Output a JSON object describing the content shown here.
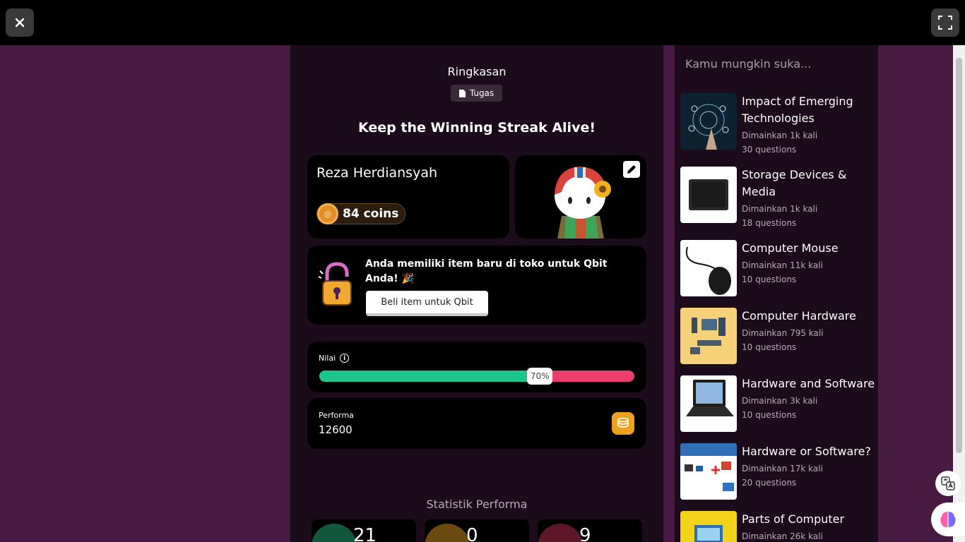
{
  "header": {
    "close_icon": "close-icon",
    "fullscreen_icon": "fullscreen-icon"
  },
  "summary": {
    "title": "Ringkasan",
    "tag_label": "Tugas"
  },
  "streak_title": "Keep the Winning Streak Alive!",
  "user": {
    "name": "Reza Herdiansyah",
    "coins": "84 coins"
  },
  "promo": {
    "text": "Anda memiliki item baru di toko untuk Qbit Anda! 🎉",
    "button_label": "Beli item untuk Qbit"
  },
  "score": {
    "label": "Nilai",
    "percent_label": "70%",
    "fraction": 0.7
  },
  "performance": {
    "label": "Performa",
    "value": "12600"
  },
  "stats": {
    "title": "Statistik Performa",
    "items": [
      {
        "value": "21",
        "color": "#10573c"
      },
      {
        "value": "0",
        "color": "#6b4a10"
      },
      {
        "value": "9",
        "color": "#5c1627"
      }
    ]
  },
  "sidebar": {
    "heading": "Kamu mungkin suka...",
    "items": [
      {
        "title": "Impact of Emerging Technologies",
        "plays": "Dimainkan 1k kali",
        "questions": "30 questions"
      },
      {
        "title": "Storage Devices & Media",
        "plays": "Dimainkan 1k kali",
        "questions": "18 questions"
      },
      {
        "title": "Computer Mouse",
        "plays": "Dimainkan 11k kali",
        "questions": "10 questions"
      },
      {
        "title": "Computer Hardware",
        "plays": "Dimainkan 795 kali",
        "questions": "10 questions"
      },
      {
        "title": "Hardware and Software",
        "plays": "Dimainkan 3k kali",
        "questions": "10 questions"
      },
      {
        "title": "Hardware or Software?",
        "plays": "Dimainkan 17k kali",
        "questions": "20 questions"
      },
      {
        "title": "Parts of Computer",
        "plays": "Dimainkan 26k kali",
        "questions": ""
      }
    ]
  },
  "colors": {
    "accent_green": "#1ec58b",
    "accent_red": "#ec3e6b",
    "page_bg": "#461a42",
    "panel_bg": "#1c0b1a"
  }
}
